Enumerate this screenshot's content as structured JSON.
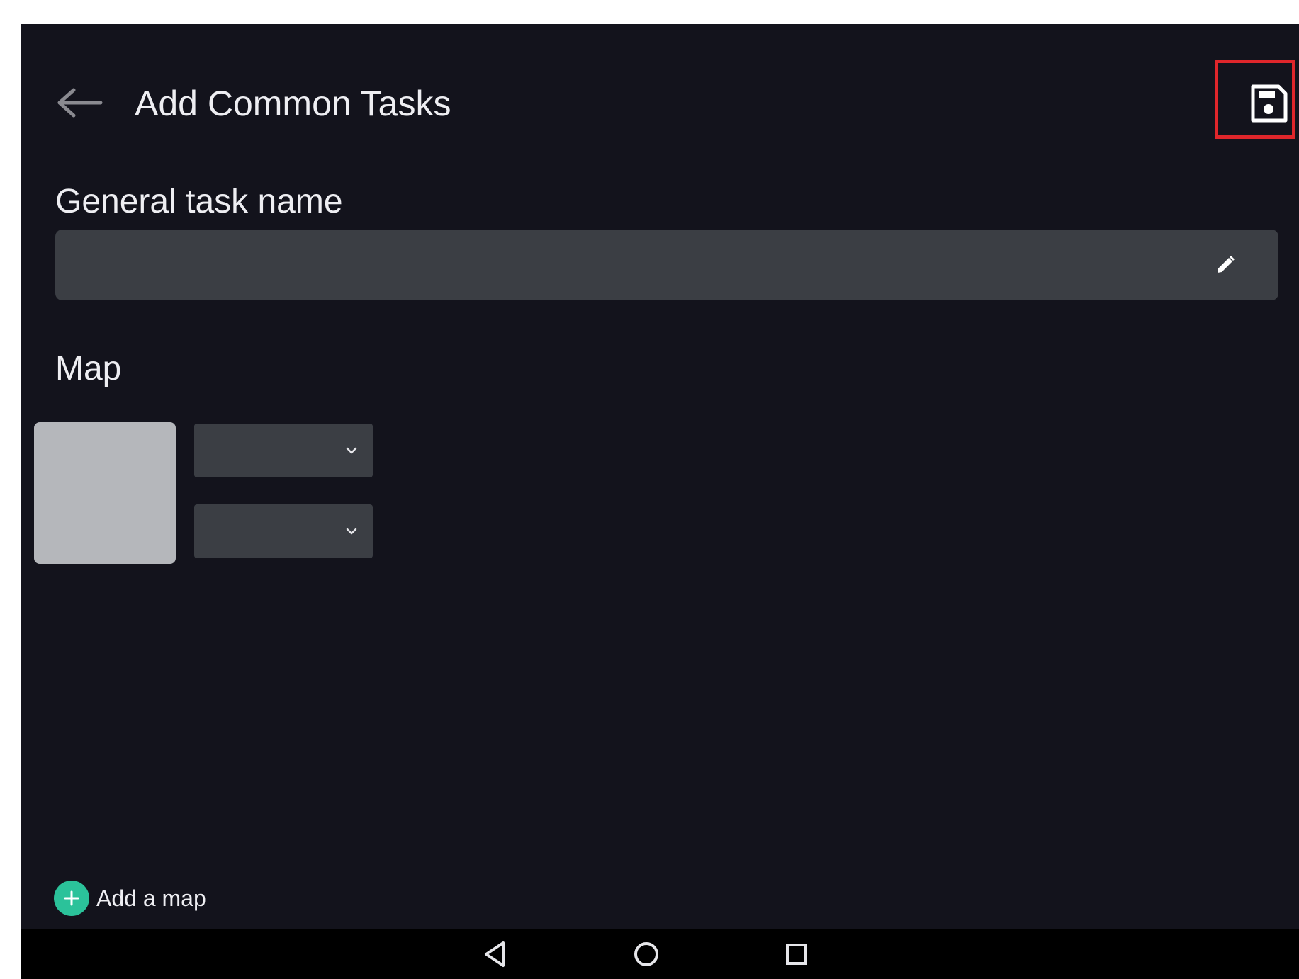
{
  "header": {
    "title": "Add Common Tasks",
    "back_icon": "arrow-left-icon",
    "save_icon": "floppy-disk-save-icon"
  },
  "task_name": {
    "label": "General task name",
    "value": "",
    "edit_icon": "pencil-icon"
  },
  "map": {
    "label": "Map",
    "dropdown_1_value": "",
    "dropdown_2_value": "",
    "dropdown_icon": "chevron-down-icon"
  },
  "add_map": {
    "label": "Add a map",
    "icon": "plus-icon"
  },
  "nav": {
    "icons": [
      "triangle-back-icon",
      "circle-home-icon",
      "square-recents-icon"
    ]
  },
  "colors": {
    "background": "#13131c",
    "field": "#3b3e44",
    "thumbnail": "#b5b7bb",
    "accent": "#2bc29a",
    "highlight": "#e0262b",
    "nav_bar": "#000000"
  }
}
